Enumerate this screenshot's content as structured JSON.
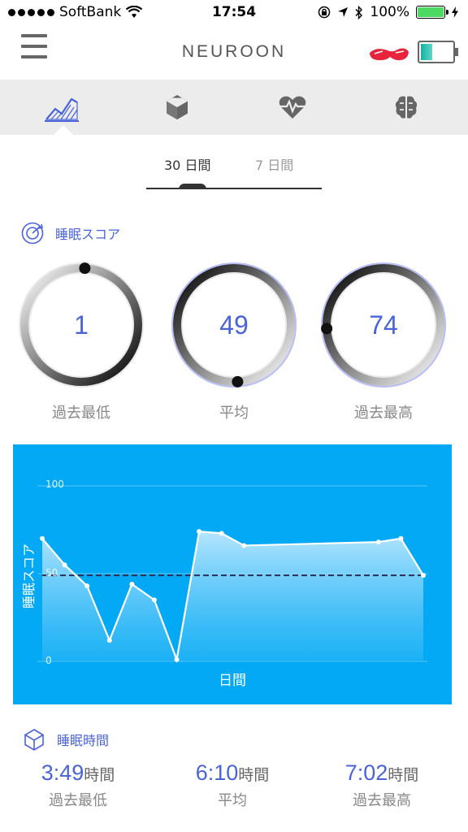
{
  "status": {
    "carrier": "SoftBank",
    "time": "17:54",
    "battery": "100%"
  },
  "header": {
    "brand": "NEUROON"
  },
  "period": {
    "active": "30 日間",
    "inactive": "7 日間"
  },
  "score": {
    "title": "睡眠スコア",
    "rings": [
      {
        "value": "1",
        "label": "過去最低"
      },
      {
        "value": "49",
        "label": "平均"
      },
      {
        "value": "74",
        "label": "過去最高"
      }
    ]
  },
  "chart_data": {
    "type": "area",
    "xlabel": "日間",
    "ylabel": "睡眠スコア",
    "ylim": [
      0,
      100
    ],
    "yticks": [
      "100",
      "50",
      "0"
    ],
    "average": 49,
    "values": [
      70,
      55,
      43,
      12,
      44,
      35,
      1,
      74,
      73,
      66,
      68,
      70,
      49
    ],
    "x": [
      0,
      1,
      2,
      3,
      4,
      5,
      6,
      7,
      8,
      9,
      15,
      16,
      17
    ],
    "colors": {
      "background": "#03a9f4",
      "line": "#ffffff",
      "average": "#2b2f55"
    }
  },
  "sleep_time": {
    "title": "睡眠時間",
    "unit": "時間",
    "stats": [
      {
        "value": "3:49",
        "label": "過去最低"
      },
      {
        "value": "6:10",
        "label": "平均"
      },
      {
        "value": "7:02",
        "label": "過去最高"
      }
    ]
  },
  "colors": {
    "accent": "#4a63d9",
    "chart_bg": "#03a9f4"
  }
}
